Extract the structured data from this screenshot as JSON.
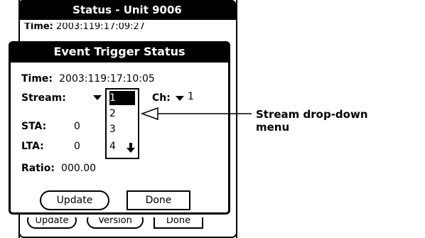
{
  "back_window": {
    "title": "Status - Unit 9006",
    "time_label": "Time:",
    "time_value": "2003:119:17:09:27",
    "buttons": [
      "Update",
      "Version",
      "Done"
    ]
  },
  "dialog": {
    "title": "Event Trigger Status",
    "time_label": "Time:",
    "time_value": "2003:119:17:10:05",
    "stream_label": "Stream:",
    "ch_label": "Ch:",
    "ch_value": "1",
    "sta_label": "STA:",
    "sta_value": "0",
    "lta_label": "LTA:",
    "lta_value": "0",
    "ratio_label": "Ratio:",
    "ratio_value": "000.00",
    "update_label": "Update",
    "done_label": "Done"
  },
  "stream_dropdown": {
    "options": [
      "1",
      "2",
      "3",
      "4"
    ],
    "selected": "1",
    "scroll_icon": "down-arrow-icon"
  },
  "callout": {
    "line1": "Stream drop-down",
    "line2": "menu"
  }
}
